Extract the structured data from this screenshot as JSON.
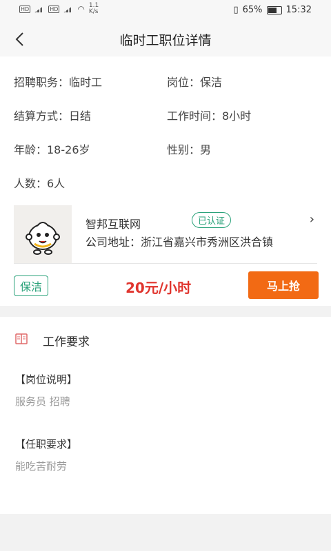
{
  "status_bar": {
    "net_speed_value": "1.1",
    "net_speed_unit": "K/s",
    "battery": "65%",
    "time": "15:32"
  },
  "header": {
    "title": "临时工职位详情"
  },
  "job_info": {
    "position_type": "招聘职务：临时工",
    "post": "岗位：保洁",
    "settlement": "结算方式：日结",
    "work_time": "工作时间：8小时",
    "age": "年龄：18-26岁",
    "gender": "性别：男",
    "headcount": "人数：6人"
  },
  "company": {
    "name": "智邦互联网",
    "verified": "已认证",
    "address": "公司地址：浙江省嘉兴市秀洲区洪合镇"
  },
  "tag": "保洁",
  "salary": "20元/小时",
  "grab_button": "马上抢",
  "requirements": {
    "title": "工作要求",
    "duty_label": "【岗位说明】",
    "duty_text": "服务员 招聘",
    "req_label": "【任职要求】",
    "req_text": "能吃苦耐劳"
  },
  "colors": {
    "accent_green": "#2aa27a",
    "salary_red": "#e0342d",
    "button_orange": "#f26a14"
  }
}
